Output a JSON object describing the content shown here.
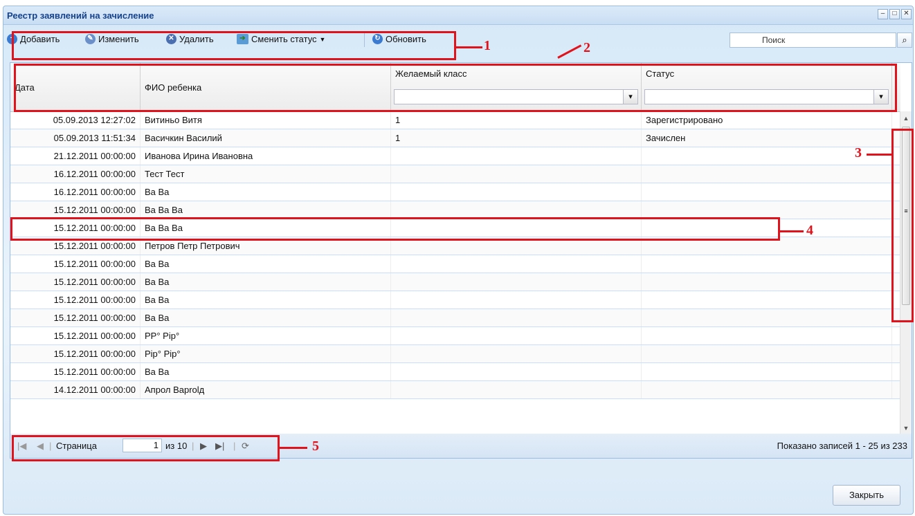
{
  "window": {
    "title": "Реестр заявлений на зачисление"
  },
  "toolbar": {
    "add_label": "Добавить",
    "edit_label": "Изменить",
    "delete_label": "Удалить",
    "change_status_label": "Сменить статус",
    "refresh_label": "Обновить",
    "search_placeholder": "Поиск"
  },
  "grid": {
    "columns": [
      "Дата",
      "ФИО ребенка",
      "Желаемый класс",
      "Статус"
    ],
    "rows": [
      {
        "date": "05.09.2013 12:27:02",
        "name": "Витиньо Витя",
        "grade": "1",
        "status": "Зарегистрировано"
      },
      {
        "date": "05.09.2013 11:51:34",
        "name": "Васичкин Василий",
        "grade": "1",
        "status": "Зачислен"
      },
      {
        "date": "21.12.2011 00:00:00",
        "name": "Иванова Ирина Ивановна",
        "grade": "",
        "status": ""
      },
      {
        "date": "16.12.2011 00:00:00",
        "name": "Тест Тест",
        "grade": "",
        "status": ""
      },
      {
        "date": "16.12.2011 00:00:00",
        "name": "Ва Ва",
        "grade": "",
        "status": ""
      },
      {
        "date": "15.12.2011 00:00:00",
        "name": "Ва Ва Ва",
        "grade": "",
        "status": ""
      },
      {
        "date": "15.12.2011 00:00:00",
        "name": "Ва Ва Ва",
        "grade": "",
        "status": ""
      },
      {
        "date": "15.12.2011 00:00:00",
        "name": "Петров Петр Петрович",
        "grade": "",
        "status": ""
      },
      {
        "date": "15.12.2011 00:00:00",
        "name": "Ва Ва",
        "grade": "",
        "status": ""
      },
      {
        "date": "15.12.2011 00:00:00",
        "name": "Ва Ва",
        "grade": "",
        "status": ""
      },
      {
        "date": "15.12.2011 00:00:00",
        "name": "Ва Ва",
        "grade": "",
        "status": ""
      },
      {
        "date": "15.12.2011 00:00:00",
        "name": "Ва Ва",
        "grade": "",
        "status": ""
      },
      {
        "date": "15.12.2011 00:00:00",
        "name": "РР° Рір°",
        "grade": "",
        "status": ""
      },
      {
        "date": "15.12.2011 00:00:00",
        "name": "Рір° Рір°",
        "grade": "",
        "status": ""
      },
      {
        "date": "15.12.2011 00:00:00",
        "name": "Ва Ва",
        "grade": "",
        "status": ""
      },
      {
        "date": "14.12.2011 00:00:00",
        "name": "Апрол Ваprolд",
        "grade": "",
        "status": ""
      }
    ]
  },
  "pager": {
    "page_label": "Страница",
    "page_value": "1",
    "of_label": "из 10",
    "summary": "Показано записей 1 - 25 из 233"
  },
  "footer": {
    "close_label": "Закрыть"
  },
  "callouts": [
    "1",
    "2",
    "3",
    "4",
    "5"
  ],
  "colors": {
    "callout_red": "#e0121b",
    "header_blue": "#15428b"
  }
}
